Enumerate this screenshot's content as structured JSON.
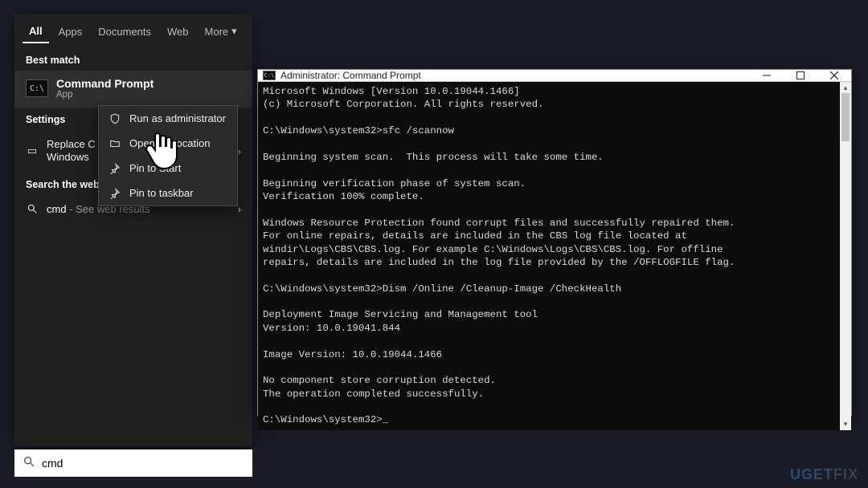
{
  "search": {
    "tabs": [
      "All",
      "Apps",
      "Documents",
      "Web",
      "More"
    ],
    "best_match_header": "Best match",
    "best_match": {
      "title": "Command Prompt",
      "subtitle": "App"
    },
    "settings_header": "Settings",
    "settings_item": "Replace Command Prompt with Windows PowerShell",
    "settings_item_short": "Replace C\nWindows",
    "search_web_header": "Search the web",
    "web_query": "cmd",
    "web_rest": " - See web results",
    "input_value": "cmd"
  },
  "context_menu": {
    "items": [
      {
        "icon": "shield",
        "label": "Run as administrator"
      },
      {
        "icon": "folder",
        "label": "Open file location"
      },
      {
        "icon": "pin",
        "label": "Pin to Start"
      },
      {
        "icon": "pin",
        "label": "Pin to taskbar"
      }
    ]
  },
  "cmd_window": {
    "title": "Administrator: Command Prompt",
    "lines": [
      "Microsoft Windows [Version 10.0.19044.1466]",
      "(c) Microsoft Corporation. All rights reserved.",
      "",
      "C:\\Windows\\system32>sfc /scannow",
      "",
      "Beginning system scan.  This process will take some time.",
      "",
      "Beginning verification phase of system scan.",
      "Verification 100% complete.",
      "",
      "Windows Resource Protection found corrupt files and successfully repaired them.",
      "For online repairs, details are included in the CBS log file located at",
      "windir\\Logs\\CBS\\CBS.log. For example C:\\Windows\\Logs\\CBS\\CBS.log. For offline",
      "repairs, details are included in the log file provided by the /OFFLOGFILE flag.",
      "",
      "C:\\Windows\\system32>Dism /Online /Cleanup-Image /CheckHealth",
      "",
      "Deployment Image Servicing and Management tool",
      "Version: 10.0.19041.844",
      "",
      "Image Version: 10.0.19044.1466",
      "",
      "No component store corruption detected.",
      "The operation completed successfully.",
      "",
      "C:\\Windows\\system32>_"
    ]
  },
  "watermark": {
    "brand": "UGET",
    "suffix": "FIX"
  }
}
